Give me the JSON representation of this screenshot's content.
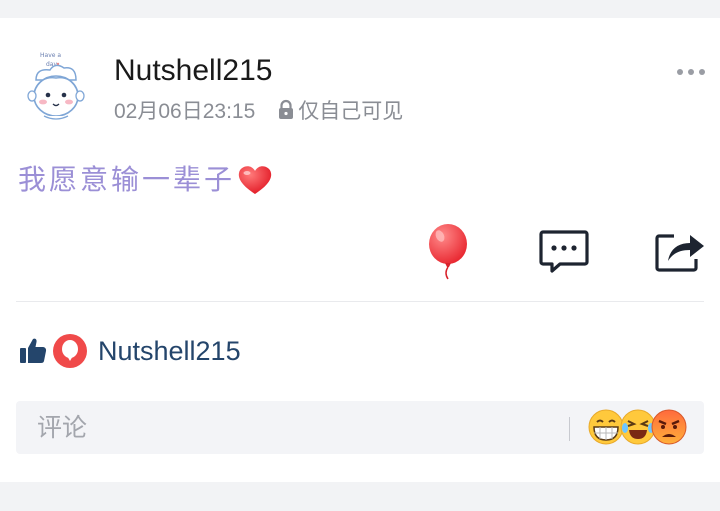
{
  "post": {
    "author": "Nutshell215",
    "timestamp": "02月06日23:15",
    "visibility": "仅自己可见",
    "text": "我愿意输一辈子",
    "text_color": "#9b8fd6"
  },
  "likes": {
    "name": "Nutshell215",
    "name_color": "#24456b"
  },
  "comment": {
    "placeholder": "评论"
  },
  "icons": {
    "avatar": "cartoon-avatar",
    "more": "more-dots-icon",
    "heart": "red-heart-icon",
    "balloon": "balloon-icon",
    "comment": "comment-bubble-icon",
    "share": "share-icon",
    "thumb": "thumbs-up-icon",
    "like_badge": "balloon-badge-icon",
    "emojis": [
      "grinning-emoji",
      "laughing-emoji",
      "angry-emoji"
    ]
  },
  "colors": {
    "accent_red": "#f04a4a",
    "icon_dark": "#1d2430",
    "thumb": "#24456b"
  }
}
